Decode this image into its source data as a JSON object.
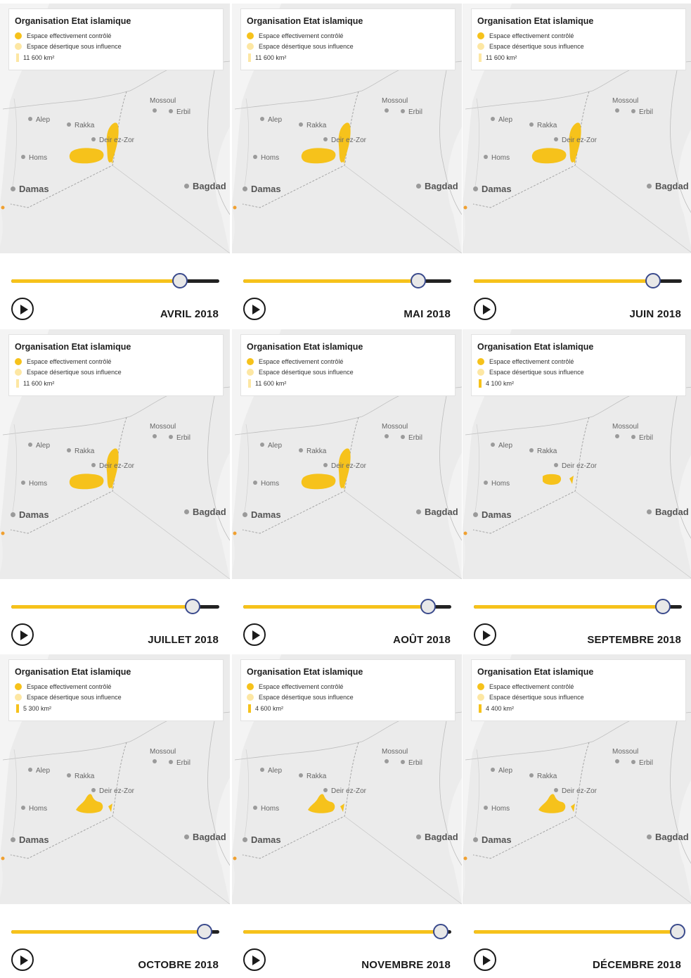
{
  "legend_labels": {
    "title": "Organisation Etat islamique",
    "controlled": "Espace effectivement contrôlé",
    "influence": "Espace désertique sous influence"
  },
  "colors": {
    "controlled": "#f6c21b",
    "influence": "#fde7a3",
    "slider_track": "#222222",
    "slider_fill": "#f6c21b",
    "thumb_ring": "#3a4a8c",
    "map_land": "#ebebeb"
  },
  "cities": {
    "alep": "Alep",
    "rakka": "Rakka",
    "mossoul": "Mossoul",
    "erbil": "Erbil",
    "deir": "Deir ez-Zor",
    "homs": "Homs",
    "damas": "Damas",
    "bagdad": "Bagdad"
  },
  "icons": {
    "play": "play-icon"
  },
  "panels": [
    {
      "month": "AVRIL 2018",
      "area": "11 600 km²",
      "shape": "wide",
      "progress": 0.81
    },
    {
      "month": "MAI 2018",
      "area": "11 600 km²",
      "shape": "wide",
      "progress": 0.84
    },
    {
      "month": "JUIN 2018",
      "area": "11 600 km²",
      "shape": "wide",
      "progress": 0.86
    },
    {
      "month": "JUILLET 2018",
      "area": "11 600 km²",
      "shape": "wide",
      "progress": 0.87
    },
    {
      "month": "AOÛT 2018",
      "area": "11 600 km²",
      "shape": "wide",
      "progress": 0.89
    },
    {
      "month": "SEPTEMBRE 2018",
      "area": "4 100 km²",
      "shape": "small",
      "progress": 0.91
    },
    {
      "month": "OCTOBRE 2018",
      "area": "5 300 km²",
      "shape": "lobed",
      "progress": 0.93
    },
    {
      "month": "NOVEMBRE 2018",
      "area": "4 600 km²",
      "shape": "lobed",
      "progress": 0.95
    },
    {
      "month": "DÉCEMBRE 2018",
      "area": "4 400 km²",
      "shape": "lobed",
      "progress": 0.98
    }
  ]
}
